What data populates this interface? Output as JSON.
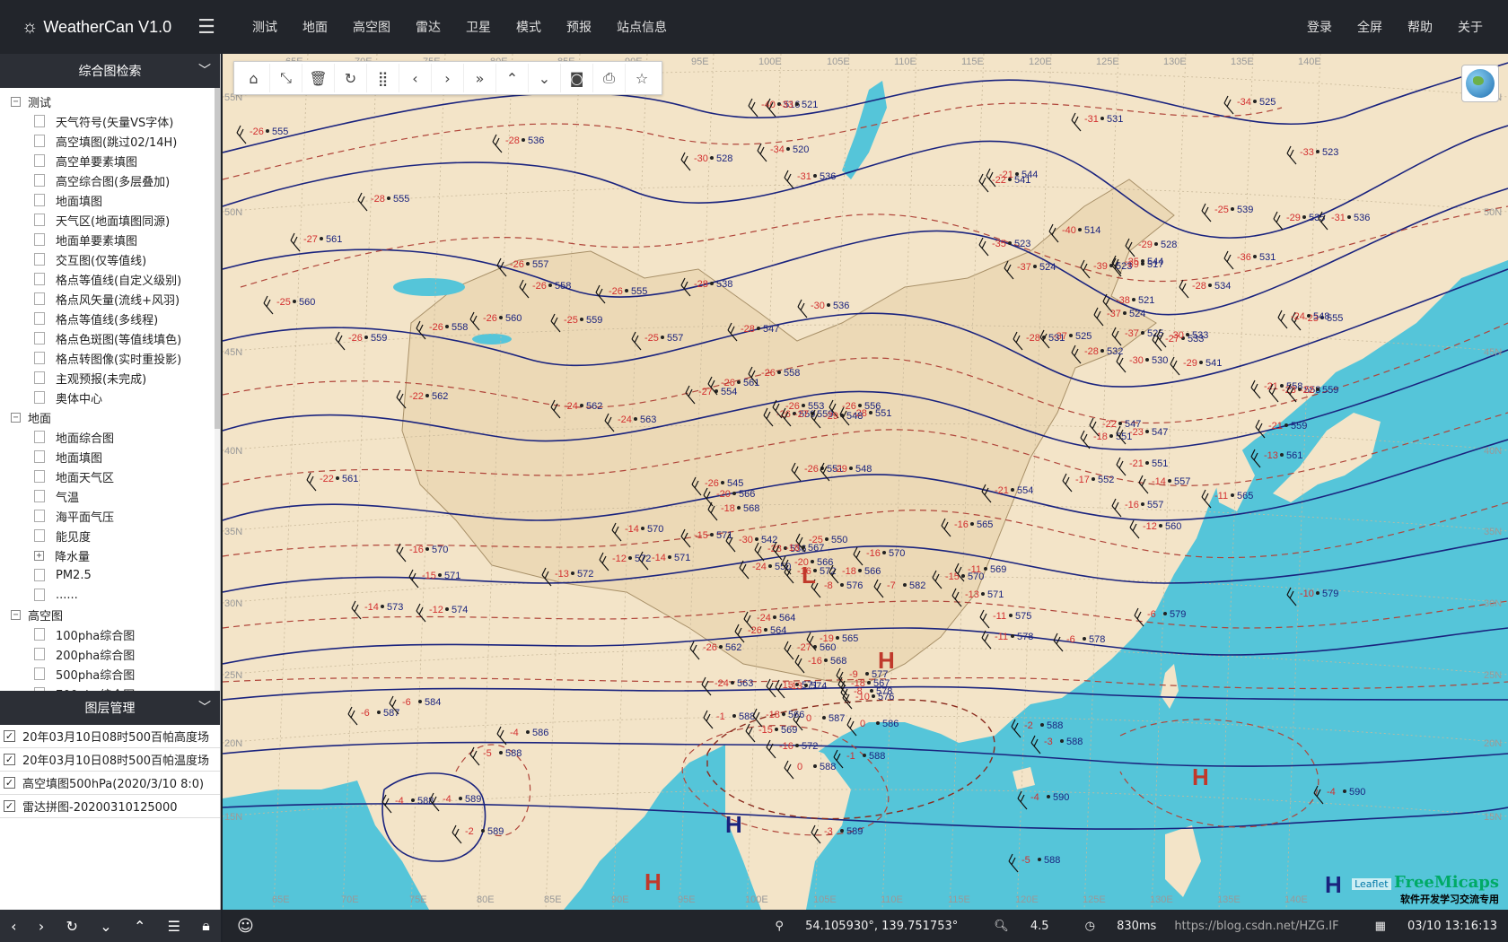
{
  "app": {
    "title": "WeatherCan V1.0"
  },
  "nav": {
    "items": [
      "测试",
      "地面",
      "高空图",
      "雷达",
      "卫星",
      "模式",
      "预报",
      "站点信息"
    ],
    "right": [
      "登录",
      "全屏",
      "帮助",
      "关于"
    ]
  },
  "sidebar": {
    "search_title": "综合图检索",
    "tree": [
      {
        "label": "测试",
        "open": true,
        "children": [
          "天气符号(矢量VS字体)",
          "高空填图(跳过02/14H)",
          "高空单要素填图",
          "高空综合图(多层叠加)",
          "地面填图",
          "天气区(地面填图同源)",
          "地面单要素填图",
          "交互图(仅等值线)",
          "格点等值线(自定义级别)",
          "格点风矢量(流线+风羽)",
          "格点等值线(多线程)",
          "格点色斑图(等值线填色)",
          "格点转图像(实时重投影)",
          "主观预报(未完成)",
          "奥体中心"
        ]
      },
      {
        "label": "地面",
        "open": true,
        "children": [
          "地面综合图",
          "地面填图",
          "地面天气区",
          "气温",
          "海平面气压",
          "能见度",
          "降水量",
          "PM2.5",
          "......"
        ]
      },
      {
        "label": "高空图",
        "open": true,
        "children": [
          "100pha综合图",
          "200pha综合图",
          "500pha综合图",
          "700pha综合图"
        ]
      }
    ],
    "layer_title": "图层管理",
    "layers": [
      "20年03月10日08时500百帕高度场",
      "20年03月10日08时500百帕温度场",
      "高空填图500hPa(2020/3/10 8:0)",
      "雷达拼图-20200310125000"
    ]
  },
  "map": {
    "lon_labels": [
      "65E",
      "70E",
      "75E",
      "80E",
      "85E",
      "90E",
      "95E",
      "100E",
      "105E",
      "110E",
      "115E",
      "120E",
      "125E",
      "130E",
      "135E",
      "140E"
    ],
    "lat_labels": [
      "55N",
      "50N",
      "45N",
      "40N",
      "35N",
      "30N",
      "25N",
      "20N",
      "15N"
    ],
    "systems": [
      {
        "symbol": "H",
        "color": "#c0392b"
      },
      {
        "symbol": "H",
        "color": "#c0392b"
      },
      {
        "symbol": "H",
        "color": "#1a237e"
      },
      {
        "symbol": "H",
        "color": "#c0392b"
      },
      {
        "symbol": "L",
        "color": "#c0392b"
      },
      {
        "symbol": "H",
        "color": "#1a237e"
      }
    ],
    "stations": [
      {
        "t": "-26",
        "h": "555"
      },
      {
        "t": "-28",
        "h": "555"
      },
      {
        "t": "-27",
        "h": "561"
      },
      {
        "t": "-25",
        "h": "560"
      },
      {
        "t": "-26",
        "h": "559"
      },
      {
        "t": "-26",
        "h": "558"
      },
      {
        "t": "-22",
        "h": "562"
      },
      {
        "t": "-22",
        "h": "561"
      },
      {
        "t": "-26",
        "h": "557"
      },
      {
        "t": "-26",
        "h": "558"
      },
      {
        "t": "-26",
        "h": "555"
      },
      {
        "t": "-26",
        "h": "560"
      },
      {
        "t": "-25",
        "h": "559"
      },
      {
        "t": "-25",
        "h": "557"
      },
      {
        "t": "-24",
        "h": "562"
      },
      {
        "t": "-24",
        "h": "563"
      },
      {
        "t": "-16",
        "h": "570"
      },
      {
        "t": "-15",
        "h": "571"
      },
      {
        "t": "-14",
        "h": "570"
      },
      {
        "t": "-14",
        "h": "571"
      },
      {
        "t": "-13",
        "h": "572"
      },
      {
        "t": "-12",
        "h": "572"
      },
      {
        "t": "-20",
        "h": "566"
      },
      {
        "t": "-18",
        "h": "568"
      },
      {
        "t": "-15",
        "h": "571"
      },
      {
        "t": "-16",
        "h": "572"
      },
      {
        "t": "-14",
        "h": "573"
      },
      {
        "t": "-12",
        "h": "574"
      },
      {
        "t": "-6",
        "h": "587"
      },
      {
        "t": "-6",
        "h": "584"
      },
      {
        "t": "-4",
        "h": "586"
      },
      {
        "t": "-5",
        "h": "588"
      },
      {
        "t": "-4",
        "h": "588"
      },
      {
        "t": "-4",
        "h": "589"
      },
      {
        "t": "-2",
        "h": "589"
      },
      {
        "t": "-1",
        "h": "588"
      },
      {
        "t": "0",
        "h": "587"
      },
      {
        "t": "0",
        "h": "588"
      },
      {
        "t": "-1",
        "h": "588"
      },
      {
        "t": "0",
        "h": "586"
      },
      {
        "t": "-3",
        "h": "589"
      },
      {
        "t": "-5",
        "h": "588"
      },
      {
        "t": "-4",
        "h": "590"
      },
      {
        "t": "-4",
        "h": "590"
      },
      {
        "t": "-2",
        "h": "588"
      },
      {
        "t": "-3",
        "h": "588"
      },
      {
        "t": "-6",
        "h": "578"
      },
      {
        "t": "-6",
        "h": "579"
      },
      {
        "t": "-10",
        "h": "579"
      },
      {
        "t": "-11",
        "h": "575"
      },
      {
        "t": "-11",
        "h": "578"
      },
      {
        "t": "-13",
        "h": "571"
      },
      {
        "t": "-15",
        "h": "570"
      },
      {
        "t": "-16",
        "h": "565"
      },
      {
        "t": "-21",
        "h": "554"
      },
      {
        "t": "-17",
        "h": "552"
      },
      {
        "t": "-16",
        "h": "557"
      },
      {
        "t": "-14",
        "h": "557"
      },
      {
        "t": "-13",
        "h": "561"
      },
      {
        "t": "-11",
        "h": "565"
      },
      {
        "t": "-11",
        "h": "569"
      },
      {
        "t": "-12",
        "h": "560"
      },
      {
        "t": "-18",
        "h": "551"
      },
      {
        "t": "-21",
        "h": "551"
      },
      {
        "t": "-22",
        "h": "547"
      },
      {
        "t": "-23",
        "h": "547"
      },
      {
        "t": "-21",
        "h": "558"
      },
      {
        "t": "-23",
        "h": "558"
      },
      {
        "t": "-21",
        "h": "559"
      },
      {
        "t": "-22",
        "h": "559"
      },
      {
        "t": "-23",
        "h": "555"
      },
      {
        "t": "-24",
        "h": "548"
      },
      {
        "t": "-25",
        "h": "544"
      },
      {
        "t": "-25",
        "h": "539"
      },
      {
        "t": "-29",
        "h": "535"
      },
      {
        "t": "-31",
        "h": "536"
      },
      {
        "t": "-28",
        "h": "534"
      },
      {
        "t": "-29",
        "h": "528"
      },
      {
        "t": "-33",
        "h": "523"
      },
      {
        "t": "-34",
        "h": "525"
      },
      {
        "t": "-36",
        "h": "531"
      },
      {
        "t": "-39",
        "h": "517"
      },
      {
        "t": "-40",
        "h": "514"
      },
      {
        "t": "-35",
        "h": "523"
      },
      {
        "t": "-37",
        "h": "524"
      },
      {
        "t": "-39",
        "h": "523"
      },
      {
        "t": "-38",
        "h": "521"
      },
      {
        "t": "-37",
        "h": "524"
      },
      {
        "t": "-37",
        "h": "525"
      },
      {
        "t": "-37",
        "h": "525"
      },
      {
        "t": "-28",
        "h": "531"
      },
      {
        "t": "-28",
        "h": "532"
      },
      {
        "t": "-27",
        "h": "533"
      },
      {
        "t": "-30",
        "h": "530"
      },
      {
        "t": "-30",
        "h": "533"
      },
      {
        "t": "-29",
        "h": "541"
      },
      {
        "t": "-22",
        "h": "541"
      },
      {
        "t": "-21",
        "h": "544"
      },
      {
        "t": "-31",
        "h": "531"
      },
      {
        "t": "-40",
        "h": "516"
      },
      {
        "t": "-33",
        "h": "521"
      },
      {
        "t": "-34",
        "h": "520"
      },
      {
        "t": "-30",
        "h": "528"
      },
      {
        "t": "-31",
        "h": "536"
      },
      {
        "t": "-28",
        "h": "536"
      },
      {
        "t": "-28",
        "h": "538"
      },
      {
        "t": "-30",
        "h": "536"
      },
      {
        "t": "-28",
        "h": "547"
      },
      {
        "t": "-27",
        "h": "554"
      },
      {
        "t": "-26",
        "h": "558"
      },
      {
        "t": "-26",
        "h": "561"
      },
      {
        "t": "-26",
        "h": "559"
      },
      {
        "t": "-27",
        "h": "559"
      },
      {
        "t": "-26",
        "h": "553"
      },
      {
        "t": "-26",
        "h": "556"
      },
      {
        "t": "-26",
        "h": "551"
      },
      {
        "t": "-29",
        "h": "548"
      },
      {
        "t": "-28",
        "h": "551"
      },
      {
        "t": "-29",
        "h": "548"
      },
      {
        "t": "-30",
        "h": "542"
      },
      {
        "t": "-28",
        "h": "536"
      },
      {
        "t": "-26",
        "h": "545"
      },
      {
        "t": "-25",
        "h": "550"
      },
      {
        "t": "-24",
        "h": "550"
      },
      {
        "t": "-24",
        "h": "564"
      },
      {
        "t": "-26",
        "h": "564"
      },
      {
        "t": "-26",
        "h": "562"
      },
      {
        "t": "-24",
        "h": "563"
      },
      {
        "t": "-27",
        "h": "560"
      },
      {
        "t": "-19",
        "h": "565"
      },
      {
        "t": "-18",
        "h": "567"
      },
      {
        "t": "-20",
        "h": "566"
      },
      {
        "t": "-18",
        "h": "566"
      },
      {
        "t": "-16",
        "h": "570"
      },
      {
        "t": "-15",
        "h": "571"
      },
      {
        "t": "-16",
        "h": "568"
      },
      {
        "t": "-18",
        "h": "566"
      },
      {
        "t": "-18",
        "h": "567"
      },
      {
        "t": "-15",
        "h": "569"
      },
      {
        "t": "-16",
        "h": "572"
      },
      {
        "t": "-13",
        "h": "574"
      },
      {
        "t": "-10",
        "h": "576"
      },
      {
        "t": "-9",
        "h": "577"
      },
      {
        "t": "-8",
        "h": "578"
      },
      {
        "t": "-8",
        "h": "576"
      },
      {
        "t": "-7",
        "h": "582"
      },
      {
        "t": "-4",
        "h": "580"
      },
      {
        "t": "-5",
        "h": "584"
      },
      {
        "t": "-5",
        "h": "582"
      },
      {
        "t": "-3",
        "h": "585"
      },
      {
        "t": "-7",
        "h": "578"
      },
      {
        "t": "-8",
        "h": "582"
      },
      {
        "t": "-5",
        "h": "586"
      },
      {
        "t": "-3",
        "h": "588"
      }
    ]
  },
  "status": {
    "coords": "54.105930°, 139.751753°",
    "zoom": "4.5",
    "timing": "830ms",
    "datetime": "03/10 13:16:13",
    "watermark": "https://blog.csdn.net/HZG.IF"
  },
  "attribution": {
    "leaflet": "Leaflet",
    "brand": "FreeMicaps",
    "slogan": "软件开发学习交流专用"
  }
}
